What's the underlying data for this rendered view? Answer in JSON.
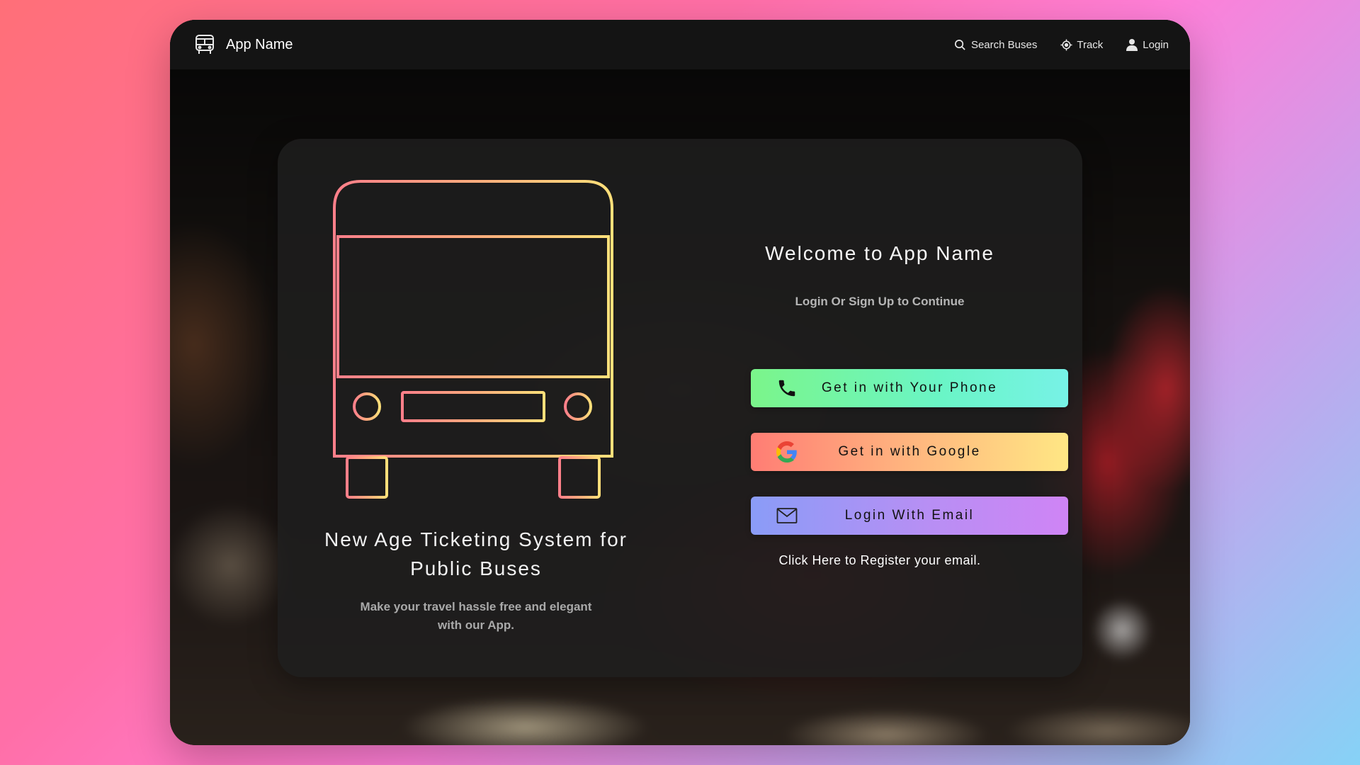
{
  "navbar": {
    "app_name": "App Name",
    "brand_icon": "bus-icon",
    "links": [
      {
        "label": "Search Buses",
        "icon": "search-icon"
      },
      {
        "label": "Track",
        "icon": "location-target-icon"
      },
      {
        "label": "Login",
        "icon": "user-icon"
      }
    ]
  },
  "hero": {
    "illustration": "bus-front-illustration",
    "tagline": "New Age Ticketing System for Public Buses",
    "subtitle": "Make your travel hassle free and elegant with our App."
  },
  "auth": {
    "title": "Welcome to App Name",
    "subtitle": "Login Or Sign Up to Continue",
    "buttons": [
      {
        "label": "Get in with Your Phone",
        "icon": "phone-icon"
      },
      {
        "label": "Get in with Google",
        "icon": "google-icon"
      },
      {
        "label": "Login With Email",
        "icon": "mail-icon"
      }
    ],
    "register_link": "Click Here to Register your email."
  },
  "colors": {
    "page_gradient": [
      "#ff6f78",
      "#ff6fa8",
      "#ff7fd8",
      "#c9a0ec",
      "#86d2f6"
    ],
    "navbar_bg": "#141414",
    "card_bg": "#1e1e1e",
    "phone_button": [
      "#7bf58a",
      "#77f2e6"
    ],
    "google_button": [
      "#ff7d74",
      "#ffe784"
    ],
    "email_button": [
      "#8a9cf7",
      "#cf84f5"
    ]
  }
}
